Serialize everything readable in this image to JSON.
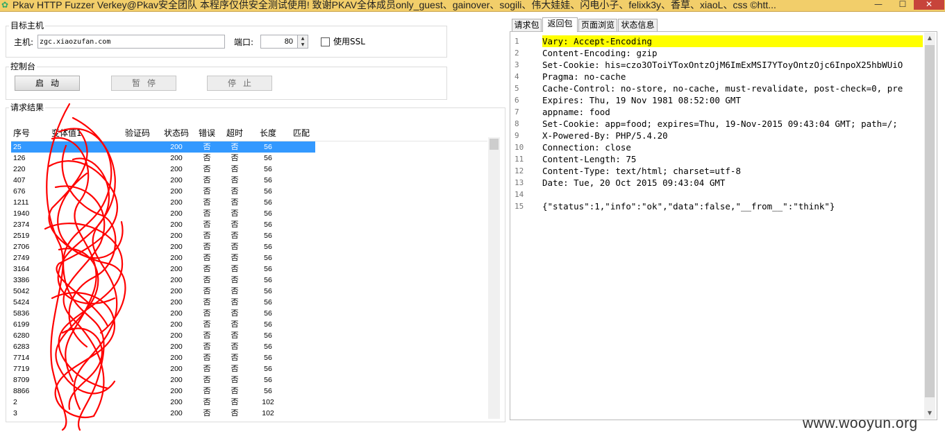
{
  "window": {
    "title": "Pkav HTTP Fuzzer   Verkey@Pkav安全团队  本程序仅供安全测试使用! 致谢PKAV全体成员only_guest、gainover、sogili、伟大娃娃、闪电小子、felixk3y、香草、xiaoL、css ©htt...",
    "min_glyph": "—",
    "max_glyph": "☐",
    "close_glyph": "✕"
  },
  "target_group": {
    "title": "目标主机",
    "host_label": "主机:",
    "host_value": "zgc.xiaozufan.com",
    "port_label": "端口:",
    "port_value": "80",
    "ssl_label": "使用SSL"
  },
  "control_group": {
    "title": "控制台",
    "start_label": "启动",
    "pause_label": "暂停",
    "stop_label": "停止"
  },
  "results_group": {
    "title": "请求结果",
    "columns": [
      "序号",
      "变体值1",
      "验证码",
      "状态码",
      "错误",
      "超时",
      "长度",
      "匹配"
    ],
    "rows": [
      {
        "id": "25",
        "status": "200",
        "error": "否",
        "timeout": "否",
        "length": "56"
      },
      {
        "id": "126",
        "status": "200",
        "error": "否",
        "timeout": "否",
        "length": "56"
      },
      {
        "id": "220",
        "status": "200",
        "error": "否",
        "timeout": "否",
        "length": "56"
      },
      {
        "id": "407",
        "status": "200",
        "error": "否",
        "timeout": "否",
        "length": "56"
      },
      {
        "id": "676",
        "status": "200",
        "error": "否",
        "timeout": "否",
        "length": "56"
      },
      {
        "id": "1211",
        "status": "200",
        "error": "否",
        "timeout": "否",
        "length": "56"
      },
      {
        "id": "1940",
        "status": "200",
        "error": "否",
        "timeout": "否",
        "length": "56"
      },
      {
        "id": "2374",
        "status": "200",
        "error": "否",
        "timeout": "否",
        "length": "56"
      },
      {
        "id": "2519",
        "status": "200",
        "error": "否",
        "timeout": "否",
        "length": "56"
      },
      {
        "id": "2706",
        "status": "200",
        "error": "否",
        "timeout": "否",
        "length": "56"
      },
      {
        "id": "2749",
        "status": "200",
        "error": "否",
        "timeout": "否",
        "length": "56"
      },
      {
        "id": "3164",
        "status": "200",
        "error": "否",
        "timeout": "否",
        "length": "56"
      },
      {
        "id": "3386",
        "status": "200",
        "error": "否",
        "timeout": "否",
        "length": "56"
      },
      {
        "id": "5042",
        "status": "200",
        "error": "否",
        "timeout": "否",
        "length": "56"
      },
      {
        "id": "5424",
        "status": "200",
        "error": "否",
        "timeout": "否",
        "length": "56"
      },
      {
        "id": "5836",
        "status": "200",
        "error": "否",
        "timeout": "否",
        "length": "56"
      },
      {
        "id": "6199",
        "status": "200",
        "error": "否",
        "timeout": "否",
        "length": "56"
      },
      {
        "id": "6280",
        "status": "200",
        "error": "否",
        "timeout": "否",
        "length": "56"
      },
      {
        "id": "6283",
        "status": "200",
        "error": "否",
        "timeout": "否",
        "length": "56"
      },
      {
        "id": "7714",
        "status": "200",
        "error": "否",
        "timeout": "否",
        "length": "56"
      },
      {
        "id": "7719",
        "status": "200",
        "error": "否",
        "timeout": "否",
        "length": "56"
      },
      {
        "id": "8709",
        "status": "200",
        "error": "否",
        "timeout": "否",
        "length": "56"
      },
      {
        "id": "8866",
        "status": "200",
        "error": "否",
        "timeout": "否",
        "length": "56"
      },
      {
        "id": "2",
        "status": "200",
        "error": "否",
        "timeout": "否",
        "length": "102"
      },
      {
        "id": "3",
        "status": "200",
        "error": "否",
        "timeout": "否",
        "length": "102"
      }
    ]
  },
  "tabs": [
    "请求包",
    "返回包",
    "页面浏览",
    "状态信息"
  ],
  "response_lines": [
    "Vary: Accept-Encoding",
    "Content-Encoding: gzip",
    "Set-Cookie: his=czo3OToiYToxOntzOjM6ImExMSI7YToyOntzOjc6InpoX25hbWUiO",
    "Pragma: no-cache",
    "Cache-Control: no-store, no-cache, must-revalidate, post-check=0, pre",
    "Expires: Thu, 19 Nov 1981 08:52:00 GMT",
    "appname: food",
    "Set-Cookie: app=food; expires=Thu, 19-Nov-2015 09:43:04 GMT; path=/;",
    "X-Powered-By: PHP/5.4.20",
    "Connection: close",
    "Content-Length: 75",
    "Content-Type: text/html; charset=utf-8",
    "Date: Tue, 20 Oct 2015 09:43:04 GMT",
    "",
    "{\"status\":1,\"info\":\"ok\",\"data\":false,\"__from__\":\"think\"}"
  ],
  "watermark": "www.wooyun.org",
  "colors": {
    "titlebar": "#f2ce6a",
    "selection": "#3399ff",
    "highlight": "#ffff00",
    "close_button": "#c7443b",
    "scribble": "#ff0000",
    "number_blue": "#1a1aa6"
  }
}
